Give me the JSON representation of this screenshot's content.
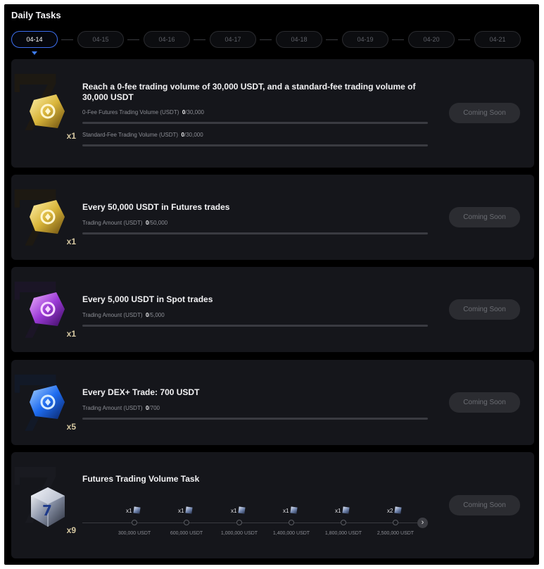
{
  "header": {
    "title": "Daily Tasks"
  },
  "dates": [
    "04-14",
    "04-15",
    "04-16",
    "04-17",
    "04-18",
    "04-19",
    "04-20",
    "04-21"
  ],
  "active_date": "04-14",
  "button_label": "Coming Soon",
  "tasks": [
    {
      "title": "Reach a 0-fee trading volume of 30,000 USDT, and a standard-fee trading volume of 30,000 USDT",
      "reward_icon": "gold-coupon-icon",
      "reward_count": "x1",
      "progress": [
        {
          "label": "0-Fee Futures Trading Volume (USDT)",
          "current": "0",
          "total": "/30,000",
          "fraction": 0
        },
        {
          "label": "Standard-Fee Trading Volume (USDT)",
          "current": "0",
          "total": "/30,000",
          "fraction": 0
        }
      ]
    },
    {
      "title": "Every 50,000 USDT in Futures trades",
      "reward_icon": "gold-coupon-icon",
      "reward_count": "x1",
      "progress": [
        {
          "label": "Trading Amount (USDT)",
          "current": "0",
          "total": "/50,000",
          "fraction": 0
        }
      ]
    },
    {
      "title": "Every 5,000 USDT in Spot trades",
      "reward_icon": "purple-coupon-icon",
      "reward_count": "x1",
      "progress": [
        {
          "label": "Trading Amount (USDT)",
          "current": "0",
          "total": "/5,000",
          "fraction": 0
        }
      ]
    },
    {
      "title": "Every DEX+ Trade: 700 USDT",
      "reward_icon": "blue-coupon-icon",
      "reward_count": "x5",
      "progress": [
        {
          "label": "Trading Amount (USDT)",
          "current": "0",
          "total": "/700",
          "fraction": 0
        }
      ]
    },
    {
      "title": "Futures Trading Volume Task",
      "reward_icon": "silver-cube-icon",
      "reward_count": "x9",
      "milestones": [
        {
          "reward": "x1",
          "amount": "300,000 USDT"
        },
        {
          "reward": "x1",
          "amount": "600,000 USDT"
        },
        {
          "reward": "x1",
          "amount": "1,000,000 USDT"
        },
        {
          "reward": "x1",
          "amount": "1,400,000 USDT"
        },
        {
          "reward": "x1",
          "amount": "1,800,000 USDT"
        },
        {
          "reward": "x2",
          "amount": "2,500,000 USDT"
        }
      ]
    }
  ],
  "colors": {
    "accent": "#3d7cf5",
    "card_bg": "#15161b",
    "page_bg": "#000000",
    "gold": "#d9b53a",
    "purple": "#9b3ad6",
    "blue": "#1e6cf0"
  }
}
